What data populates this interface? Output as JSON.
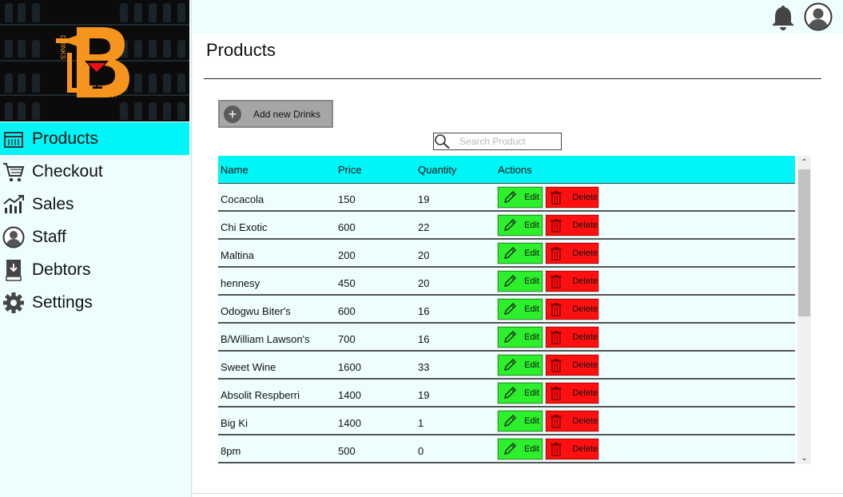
{
  "brand": {
    "logo_text": "DRINKS BAR"
  },
  "sidebar": {
    "items": [
      {
        "label": "Products",
        "icon": "products-icon",
        "active": true
      },
      {
        "label": "Checkout",
        "icon": "cart-icon",
        "active": false
      },
      {
        "label": "Sales",
        "icon": "chart-icon",
        "active": false
      },
      {
        "label": "Staff",
        "icon": "user-icon",
        "active": false
      },
      {
        "label": "Debtors",
        "icon": "book-icon",
        "active": false
      },
      {
        "label": "Settings",
        "icon": "gear-icon",
        "active": false
      }
    ]
  },
  "topbar": {
    "notification_icon": "bell-icon",
    "profile_icon": "user-avatar-icon"
  },
  "main": {
    "title": "Products",
    "add_button_label": "Add new Drinks",
    "search": {
      "placeholder": "Search Product",
      "value": ""
    }
  },
  "table": {
    "columns": [
      "Name",
      "Price",
      "Quantity",
      "Actions"
    ],
    "edit_label": "Edit",
    "delete_label": "Delete",
    "rows": [
      {
        "name": "Cocacola",
        "price": "150",
        "quantity": "19"
      },
      {
        "name": "Chi Exotic",
        "price": "600",
        "quantity": "22"
      },
      {
        "name": "Maltina",
        "price": "200",
        "quantity": "20"
      },
      {
        "name": "hennesy",
        "price": "450",
        "quantity": "20"
      },
      {
        "name": "Odogwu Biter's",
        "price": "600",
        "quantity": "16"
      },
      {
        "name": "B/William Lawson's",
        "price": "700",
        "quantity": "16"
      },
      {
        "name": "Sweet Wine",
        "price": "1600",
        "quantity": "33"
      },
      {
        "name": "Absolit Respberri",
        "price": "1400",
        "quantity": "19"
      },
      {
        "name": "Big Ki",
        "price": "1400",
        "quantity": "1"
      },
      {
        "name": "8pm",
        "price": "500",
        "quantity": "0"
      }
    ]
  },
  "colors": {
    "accent": "#00f5f7",
    "edit": "#2bf02b",
    "delete": "#ff1010",
    "brand_orange": "#f7941d",
    "background": "#eefefe"
  }
}
